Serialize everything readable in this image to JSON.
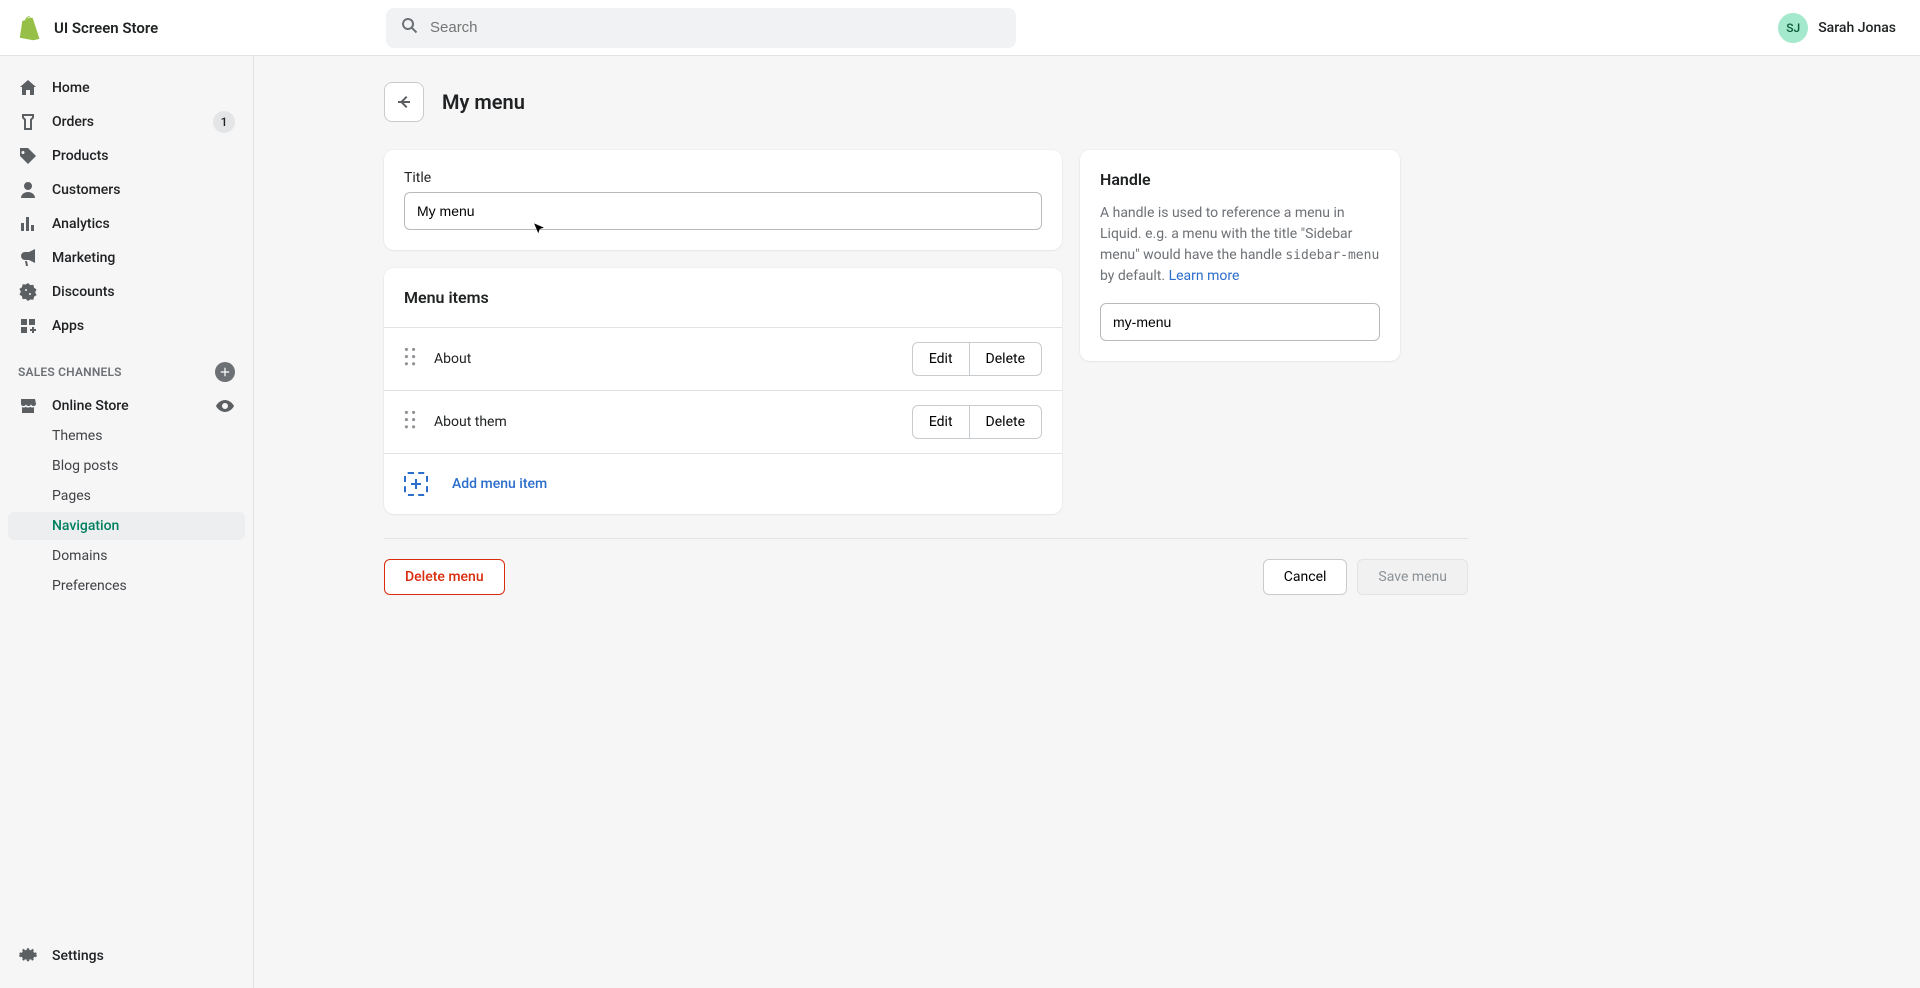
{
  "header": {
    "store_name": "UI Screen Store",
    "search_placeholder": "Search",
    "user_initials": "SJ",
    "user_name": "Sarah Jonas"
  },
  "sidebar": {
    "items": [
      {
        "label": "Home"
      },
      {
        "label": "Orders",
        "badge": "1"
      },
      {
        "label": "Products"
      },
      {
        "label": "Customers"
      },
      {
        "label": "Analytics"
      },
      {
        "label": "Marketing"
      },
      {
        "label": "Discounts"
      },
      {
        "label": "Apps"
      }
    ],
    "section_label": "SALES CHANNELS",
    "channel_label": "Online Store",
    "subitems": [
      {
        "label": "Themes"
      },
      {
        "label": "Blog posts"
      },
      {
        "label": "Pages"
      },
      {
        "label": "Navigation"
      },
      {
        "label": "Domains"
      },
      {
        "label": "Preferences"
      }
    ],
    "settings_label": "Settings"
  },
  "page": {
    "title": "My menu",
    "title_field_label": "Title",
    "title_field_value": "My menu",
    "menu_items_heading": "Menu items",
    "items": [
      {
        "label": "About",
        "edit": "Edit",
        "delete": "Delete"
      },
      {
        "label": "About them",
        "edit": "Edit",
        "delete": "Delete"
      }
    ],
    "add_item_label": "Add menu item",
    "handle_heading": "Handle",
    "handle_desc_1": "A handle is used to reference a menu in Liquid. e.g. a menu with the title \"Sidebar menu\" would have the handle ",
    "handle_code": "sidebar-menu",
    "handle_desc_2": " by default. ",
    "handle_link": "Learn more",
    "handle_value": "my-menu",
    "delete_menu": "Delete menu",
    "cancel": "Cancel",
    "save": "Save menu"
  }
}
